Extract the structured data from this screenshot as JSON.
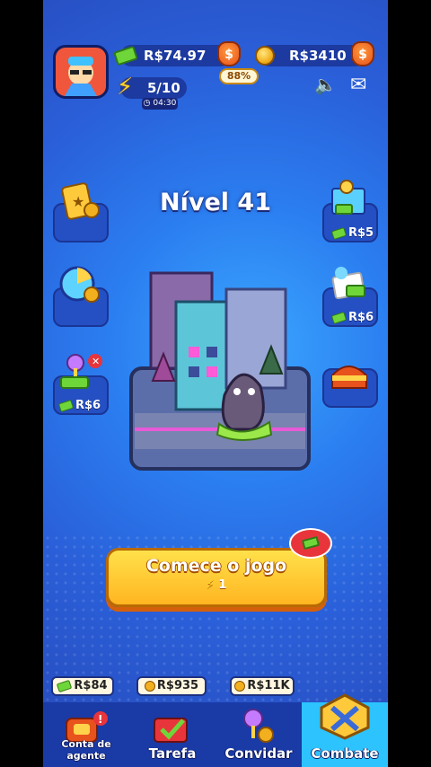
{
  "header": {
    "cash_value": "R$74.97",
    "gold_value": "R$3410",
    "cash_bag_percent": "88%",
    "energy": "5/10",
    "energy_timer": "04:30"
  },
  "level_title": "Nível 41",
  "side_left": [
    {
      "name": "cards",
      "label": ""
    },
    {
      "name": "wheel",
      "label": ""
    },
    {
      "name": "pinball",
      "label": "R$6"
    }
  ],
  "side_right": [
    {
      "name": "map",
      "label": "R$5"
    },
    {
      "name": "ticket",
      "label": "R$6"
    },
    {
      "name": "chest",
      "label": ""
    }
  ],
  "start_button": {
    "label": "Comece o jogo",
    "cost": "1"
  },
  "bottom_nav": {
    "items": [
      {
        "label": "Conta de agente",
        "reward": "R$84",
        "active": false
      },
      {
        "label": "Tarefa",
        "reward": "R$935",
        "active": false
      },
      {
        "label": "Convidar",
        "reward": "R$11K",
        "active": false
      },
      {
        "label": "Combate",
        "reward": "",
        "active": true
      }
    ]
  },
  "colors": {
    "background": "#2a5fd9",
    "start_button": "#ffc52e",
    "nav_active": "#2dc3ff"
  }
}
